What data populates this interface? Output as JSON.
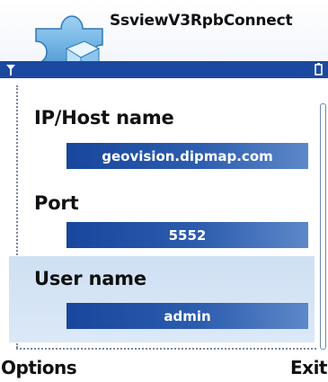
{
  "header": {
    "title": "SsviewV3RpbConnect",
    "app_icon": "puzzle-piece-icon",
    "status_icons": [
      "signal-antenna-icon",
      "battery-icon"
    ]
  },
  "form": {
    "fields": [
      {
        "label": "IP/Host name",
        "value": "geovision.dipmap.com"
      },
      {
        "label": "Port",
        "value": "5552"
      },
      {
        "label": "User name",
        "value": "admin"
      }
    ]
  },
  "softkeys": {
    "left": "Options",
    "right": "Exit"
  },
  "colors": {
    "status_bar": "#1c49a0",
    "field_bg_start": "#17469c",
    "field_bg_end": "#5d88c8",
    "selection_band": "#d6e5f6"
  }
}
